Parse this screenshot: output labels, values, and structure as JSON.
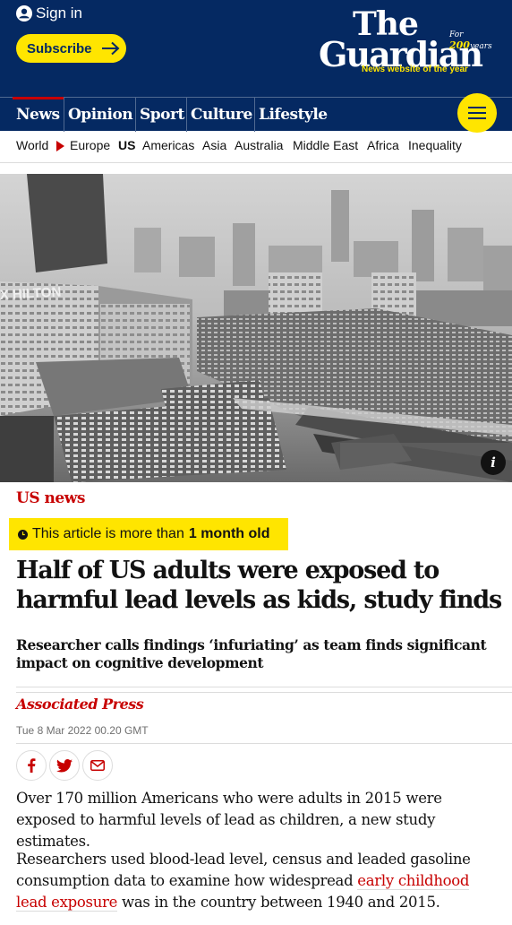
{
  "header": {
    "signin_label": "Sign in",
    "subscribe_label": "Subscribe",
    "logo_the": "The",
    "logo_guardian": "Guardian",
    "logo_for": "For",
    "logo_200": "200",
    "logo_years": "years",
    "logo_tagline": "News website of the year"
  },
  "pillars": [
    "News",
    "Opinion",
    "Sport",
    "Culture",
    "Lifestyle"
  ],
  "subnav": [
    "World",
    "Europe",
    "US",
    "Americas",
    "Asia",
    "Australia",
    "Middle East",
    "Africa",
    "Inequality"
  ],
  "article": {
    "kicker": "US news",
    "age_prefix": "This article is more than",
    "age_bold": "1 month old",
    "headline": "Half of US adults were exposed to harmful lead levels as kids, study finds",
    "standfirst": "Researcher calls findings ‘infuriating’ as team finds significant impact on cognitive development",
    "byline": "Associated Press",
    "date": "Tue 8 Mar 2022 00.20 GMT",
    "p1": "Over 170 million Americans who were adults in 2015 were exposed to harmful levels of lead as children, a new study estimates.",
    "p2_before": "Researchers used blood-lead level, census and leaded gasoline consumption data to examine how widespread ",
    "p2_link": "early childhood lead exposure",
    "p2_after": " was in the country between 1940 and 2015."
  },
  "image": {
    "sign_text": "X HILTON",
    "info_label": "i"
  },
  "colors": {
    "brand_blue": "#052962",
    "accent_yellow": "#ffe500",
    "news_red": "#c70000"
  }
}
